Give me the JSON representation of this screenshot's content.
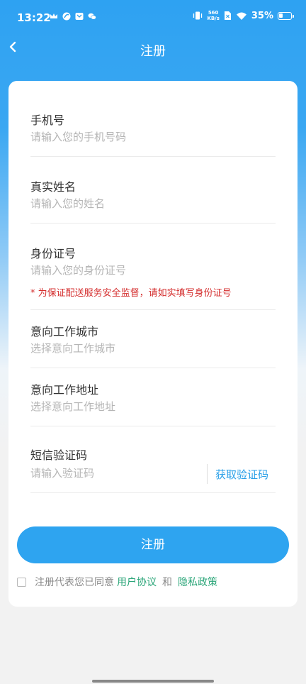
{
  "status_bar": {
    "time": "13:22",
    "net_speed_value": "560",
    "net_speed_unit": "KB/s",
    "battery": "35%",
    "battery_level": 0.35
  },
  "nav": {
    "title": "注册"
  },
  "form": {
    "phone": {
      "label": "手机号",
      "placeholder": "请输入您的手机号码"
    },
    "name": {
      "label": "真实姓名",
      "placeholder": "请输入您的姓名"
    },
    "id_card": {
      "label": "身份证号",
      "placeholder": "请输入您的身份证号",
      "warning": "* 为保证配送服务安全监督，请如实填写身份证号"
    },
    "city": {
      "label": "意向工作城市",
      "placeholder": "选择意向工作城市"
    },
    "address": {
      "label": "意向工作地址",
      "placeholder": "选择意向工作地址"
    },
    "sms_code": {
      "label": "短信验证码",
      "placeholder": "请输入验证码",
      "get_code": "获取验证码"
    }
  },
  "submit_label": "注册",
  "agreement": {
    "prefix": "注册代表您已同意",
    "user_agreement": "用户协议",
    "and": "和",
    "privacy_policy": "隐私政策"
  },
  "colors": {
    "header_blue": "#2ea2f2",
    "button_blue": "#2ea4f0",
    "warning_red": "#d42d2d",
    "link_green": "#2aa578"
  }
}
